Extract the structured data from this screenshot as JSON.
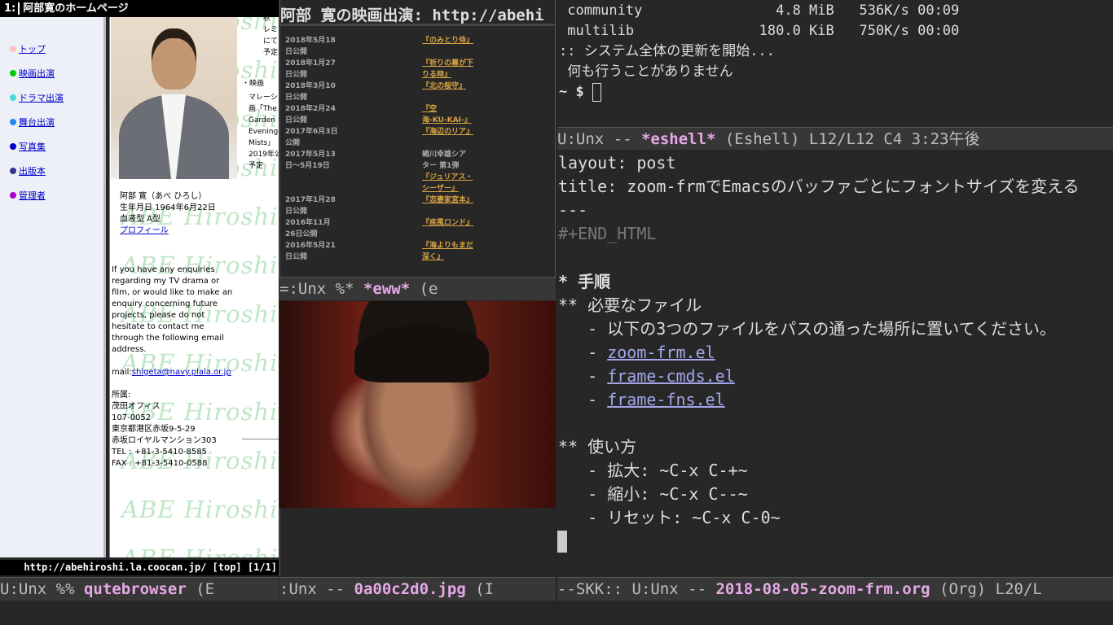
{
  "qutebrowser": {
    "tab_number": "1:",
    "tab_title": "阿部寛のホームページ",
    "nav": [
      {
        "label": "トップ",
        "color": "#ffc0cb"
      },
      {
        "label": "映画出演",
        "color": "#00cc00"
      },
      {
        "label": "ドラマ出演",
        "color": "#44dddd"
      },
      {
        "label": "舞台出演",
        "color": "#2288ee"
      },
      {
        "label": "写真集",
        "color": "#0000cc"
      },
      {
        "label": "出版本",
        "color": "#333388"
      },
      {
        "label": "管理者",
        "color": "#aa00cc"
      }
    ],
    "watermark": "ABE Hiroshi",
    "right_col": [
      "秋",
      "レミ",
      "にて",
      "予定",
      "・映画",
      "マレーシ",
      "画「The",
      "Garden",
      "Evening",
      "Mists」",
      "2019年公",
      "予定"
    ],
    "profile": [
      "阿部 寛（あべ ひろし）",
      "生年月日 1964年6月22日",
      "血液型 A型"
    ],
    "profile_link": "プロフィール",
    "enquiry": [
      "If you have any enquiries",
      "regarding my TV drama or",
      "film, or would like to make an",
      "enquiry concerning future",
      "projects, please do not",
      "hesitate to contact me",
      "through the following email",
      "address."
    ],
    "mail_prefix": "mail:",
    "mail": "shigeta@navy.plala.or.jp",
    "office": [
      "所属:",
      "茂田オフィス",
      "107-0052",
      "東京都港区赤坂9-5-29",
      "赤坂ロイヤルマンション303",
      "TEL : +81-3-5410-8585",
      "FAX : +81-3-5410-0588"
    ],
    "status_url": "http://abehiroshi.la.coocan.jp/ [top] [1/1]",
    "modeline": {
      "prefix": "U:Unx %% ",
      "name": "qutebrowser",
      "suffix": "   (E"
    }
  },
  "eww": {
    "heading": "阿部 寛の映画出演: http://abehi",
    "movies": [
      {
        "date": "2018年5月18",
        "date2": "日公開",
        "title": "『のみとり侍』"
      },
      {
        "date": "2018年1月27",
        "date2": "日公開",
        "title": "『祈りの幕が下",
        "title2": "りる時』"
      },
      {
        "date": "2018年3月10",
        "date2": "日公開",
        "title": "『北の桜守』"
      },
      {
        "date": "2018年2月24",
        "date2": "日公開",
        "title": "『空",
        "title2": "海-KU-KAI-』"
      },
      {
        "date": "2017年6月3日",
        "date2": "公開",
        "title": "『海辺のリア』"
      },
      {
        "date": "2017年5月13",
        "date2": "日〜5月19日",
        "title": "蜷川幸雄シア",
        "title2": "ター 第1弾",
        "title3": "『ジュリアス・",
        "title4": "シーザー』"
      },
      {
        "date": "2017年1月28",
        "date2": "日公開",
        "title": "『恋妻家宮本』"
      },
      {
        "date": "2016年11月",
        "date2": "26日公開",
        "title": "『疾風ロンド』"
      },
      {
        "date": "2016年5月21",
        "date2": "日公開",
        "title": "『海よりもまだ",
        "title2": "深く』"
      }
    ],
    "modeline": {
      "prefix": " =:Unx %* ",
      "name": "*eww*",
      "suffix": "      (e"
    }
  },
  "image": {
    "modeline": {
      "prefix": " :Unx -- ",
      "name": "0a00c2d0.jpg",
      "suffix": "  (I"
    }
  },
  "terminal": {
    "lines": [
      " community                4.8 MiB   536K/s 00:09",
      " multilib               180.0 KiB   750K/s 00:00",
      ":: システム全体の更新を開始...",
      " 何も行うことがありません"
    ],
    "prompt": "~ $ ",
    "modeline": {
      "prefix": " U:Unx -- ",
      "name": "*eshell*",
      "suffix": "     (Eshell) L12/L12  C4 3:23午後"
    }
  },
  "org": {
    "layout": "layout: post",
    "title": "title: zoom-frmでEmacsのバッファごとにフォントサイズを変える",
    "sep": "---",
    "end_html": "#+END_HTML",
    "h1": "* 手順",
    "h2a": "** 必要なファイル",
    "item1": "   - 以下の3つのファイルをパスの通った場所に置いてください。",
    "bullet": "   - ",
    "files": [
      "zoom-frm.el",
      "frame-cmds.el",
      "frame-fns.el"
    ],
    "h2b": "** 使い方",
    "usage": [
      "   - 拡大: ~C-x C-+~",
      "   - 縮小: ~C-x C--~",
      "   - リセット: ~C-x C-0~"
    ],
    "modeline": {
      "prefix": "--SKK:: U:Unx -- ",
      "name": "2018-08-05-zoom-frm.org",
      "suffix": "  (Org) L20/L"
    }
  }
}
